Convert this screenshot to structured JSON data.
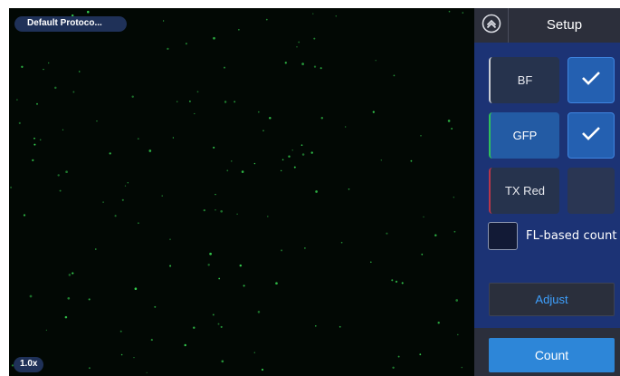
{
  "viewer": {
    "protocol_label": "Default Protoco...",
    "zoom_label": "1.0x"
  },
  "panel": {
    "title": "Setup",
    "channels": [
      {
        "label": "BF",
        "checked": true
      },
      {
        "label": "GFP",
        "checked": true
      },
      {
        "label": "TX Red",
        "checked": false
      }
    ],
    "fl_based_count": {
      "label": "FL-based count",
      "checked": false
    },
    "adjust_label": "Adjust",
    "count_label": "Count"
  },
  "icons": {
    "home": "home-chevron-icon",
    "check": "checkmark-icon"
  },
  "colors": {
    "panel_bg": "#1c3375",
    "active_button": "#2460b1",
    "count_button": "#2d86d8",
    "adjust_text": "#3ea1ff",
    "gfp_accent": "#2fbf5b",
    "txred_accent": "#b7364a",
    "cell_dot": "#35d14f"
  }
}
